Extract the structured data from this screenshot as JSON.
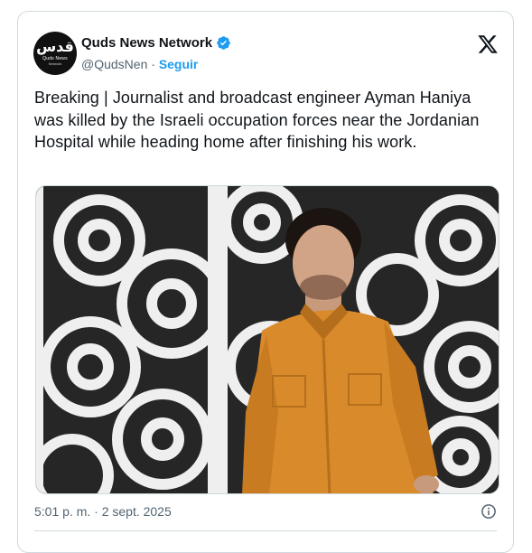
{
  "account": {
    "name": "Quds News Network",
    "handle": "@QudsNen",
    "separator": " · ",
    "follow_label": "Seguir",
    "avatar_glyph": "قدس",
    "avatar_line1": "Quds News",
    "avatar_line2": "Network"
  },
  "tweet": {
    "text": "Breaking | Journalist and broadcast engineer Ayman Haniya was killed by the Israeli occupation forces near the Jordanian Hospital while heading home after finishing his work.",
    "timestamp": "5:01 p. m. · 2 sept. 2025"
  },
  "media": {
    "description_icon": "photo",
    "shirt_color": "#d98a2b",
    "background_color": "#2a2a2a",
    "pattern_color": "#f2f2f2"
  },
  "icons": {
    "verified": "verified-badge-icon",
    "logo": "x-logo-icon",
    "info": "info-icon"
  },
  "colors": {
    "link": "#1d9bf0",
    "secondary_text": "#536471",
    "border": "#cfd9de"
  }
}
